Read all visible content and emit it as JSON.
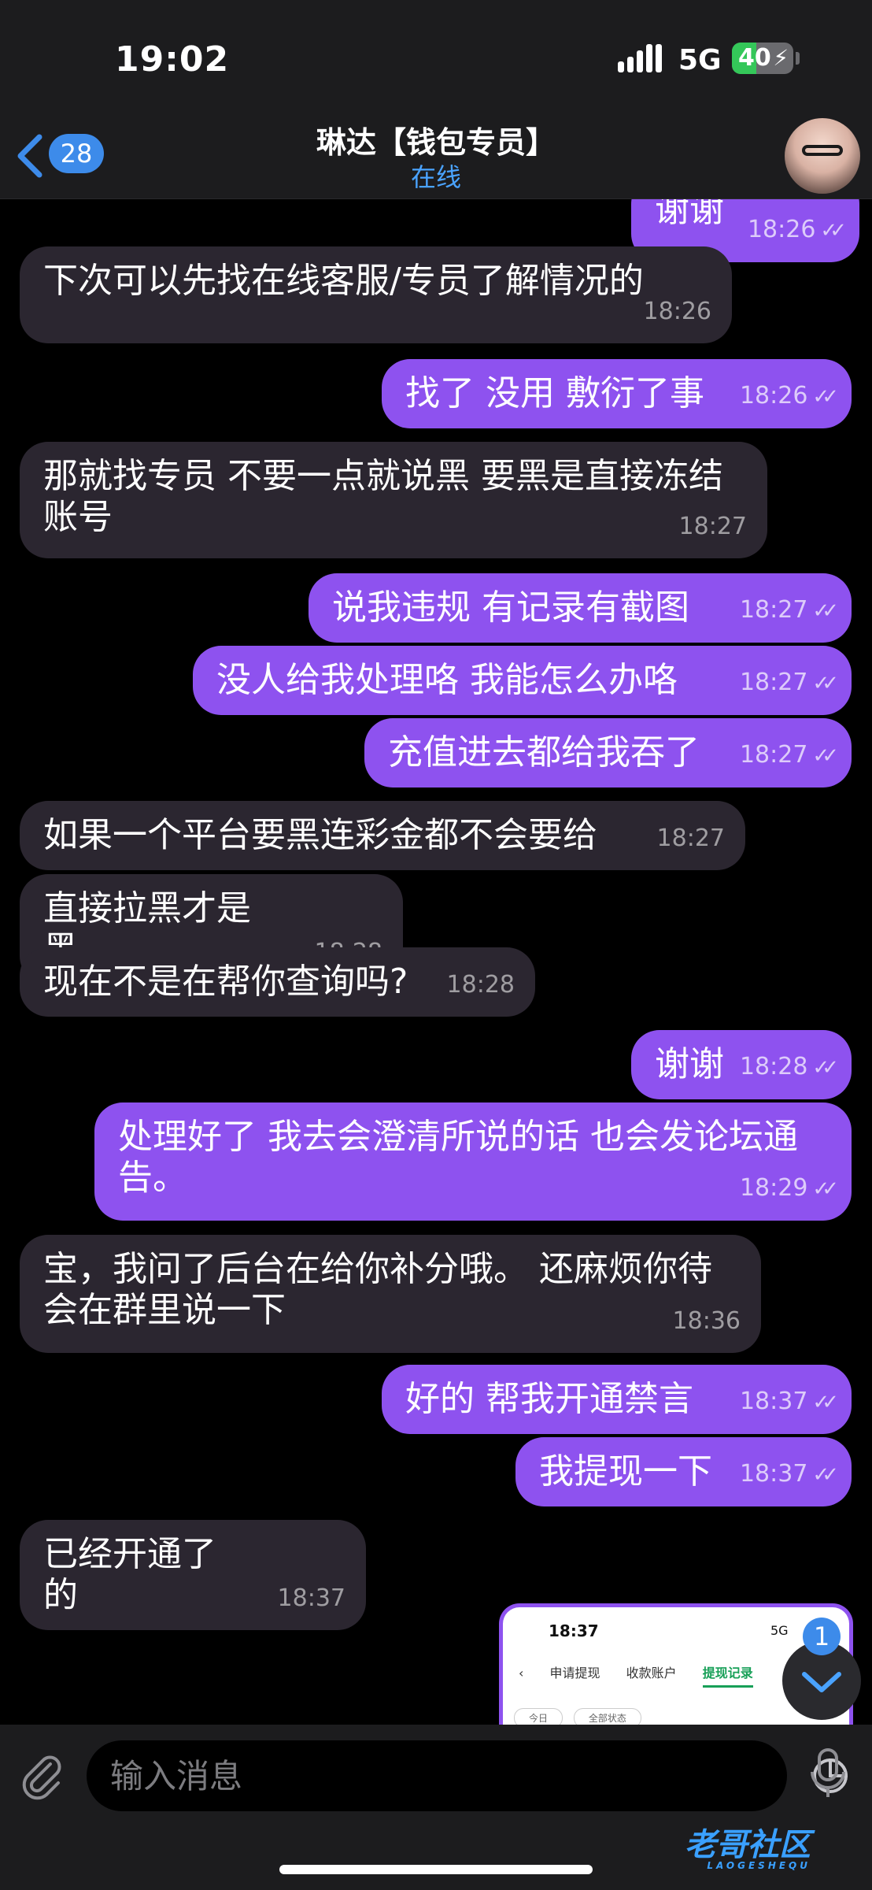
{
  "status": {
    "time": "19:02",
    "network": "5G",
    "battery": "40",
    "battery_level": 0.4
  },
  "header": {
    "back_count": "28",
    "title": "琳达【钱包专员】",
    "subtitle": "在线"
  },
  "messages": [
    {
      "dir": "out",
      "text": "谢谢",
      "time": "18:26"
    },
    {
      "dir": "in",
      "text": "下次可以先找在线客服/专员了解情况的",
      "time": "18:26"
    },
    {
      "dir": "out",
      "text": "找了 没用 敷衍了事",
      "time": "18:26"
    },
    {
      "dir": "in",
      "text": "那就找专员 不要一点就说黑 要黑是直接冻结账号",
      "time": "18:27"
    },
    {
      "dir": "out",
      "text": "说我违规  有记录有截图",
      "time": "18:27"
    },
    {
      "dir": "out",
      "text": "没人给我处理咯  我能怎么办咯",
      "time": "18:27"
    },
    {
      "dir": "out",
      "text": "充值进去都给我吞了",
      "time": "18:27"
    },
    {
      "dir": "in",
      "text": "如果一个平台要黑连彩金都不会要给",
      "time": "18:27"
    },
    {
      "dir": "in",
      "text": "直接拉黑才是黑",
      "time": "18:28"
    },
    {
      "dir": "in",
      "text": "现在不是在帮你查询吗?",
      "time": "18:28"
    },
    {
      "dir": "out",
      "text": "谢谢",
      "time": "18:28"
    },
    {
      "dir": "out",
      "text": "处理好了  我去会澄清所说的话 也会发论坛通告。",
      "time": "18:29"
    },
    {
      "dir": "in",
      "text": "宝，我问了后台在给你补分哦。 还麻烦你待会在群里说一下",
      "time": "18:36"
    },
    {
      "dir": "out",
      "text": "好的  帮我开通禁言",
      "time": "18:37"
    },
    {
      "dir": "out",
      "text": "我提现一下",
      "time": "18:37"
    },
    {
      "dir": "in",
      "text": "已经开通了的",
      "time": "18:37"
    }
  ],
  "ticks": "✓✓",
  "image_preview": {
    "time": "18:37",
    "network": "5G",
    "tabs": [
      "申请提现",
      "收款账户",
      "提现记录"
    ],
    "filters": [
      "今日",
      "全部状态"
    ]
  },
  "scroll_badge": "1",
  "input": {
    "placeholder": "输入消息"
  },
  "watermark": {
    "text": "老哥社区",
    "sub": "LAOGESHEQU"
  },
  "colors": {
    "incoming": "#2b2630",
    "outgoing": "#8e52ef",
    "accent": "#3d8bea"
  }
}
